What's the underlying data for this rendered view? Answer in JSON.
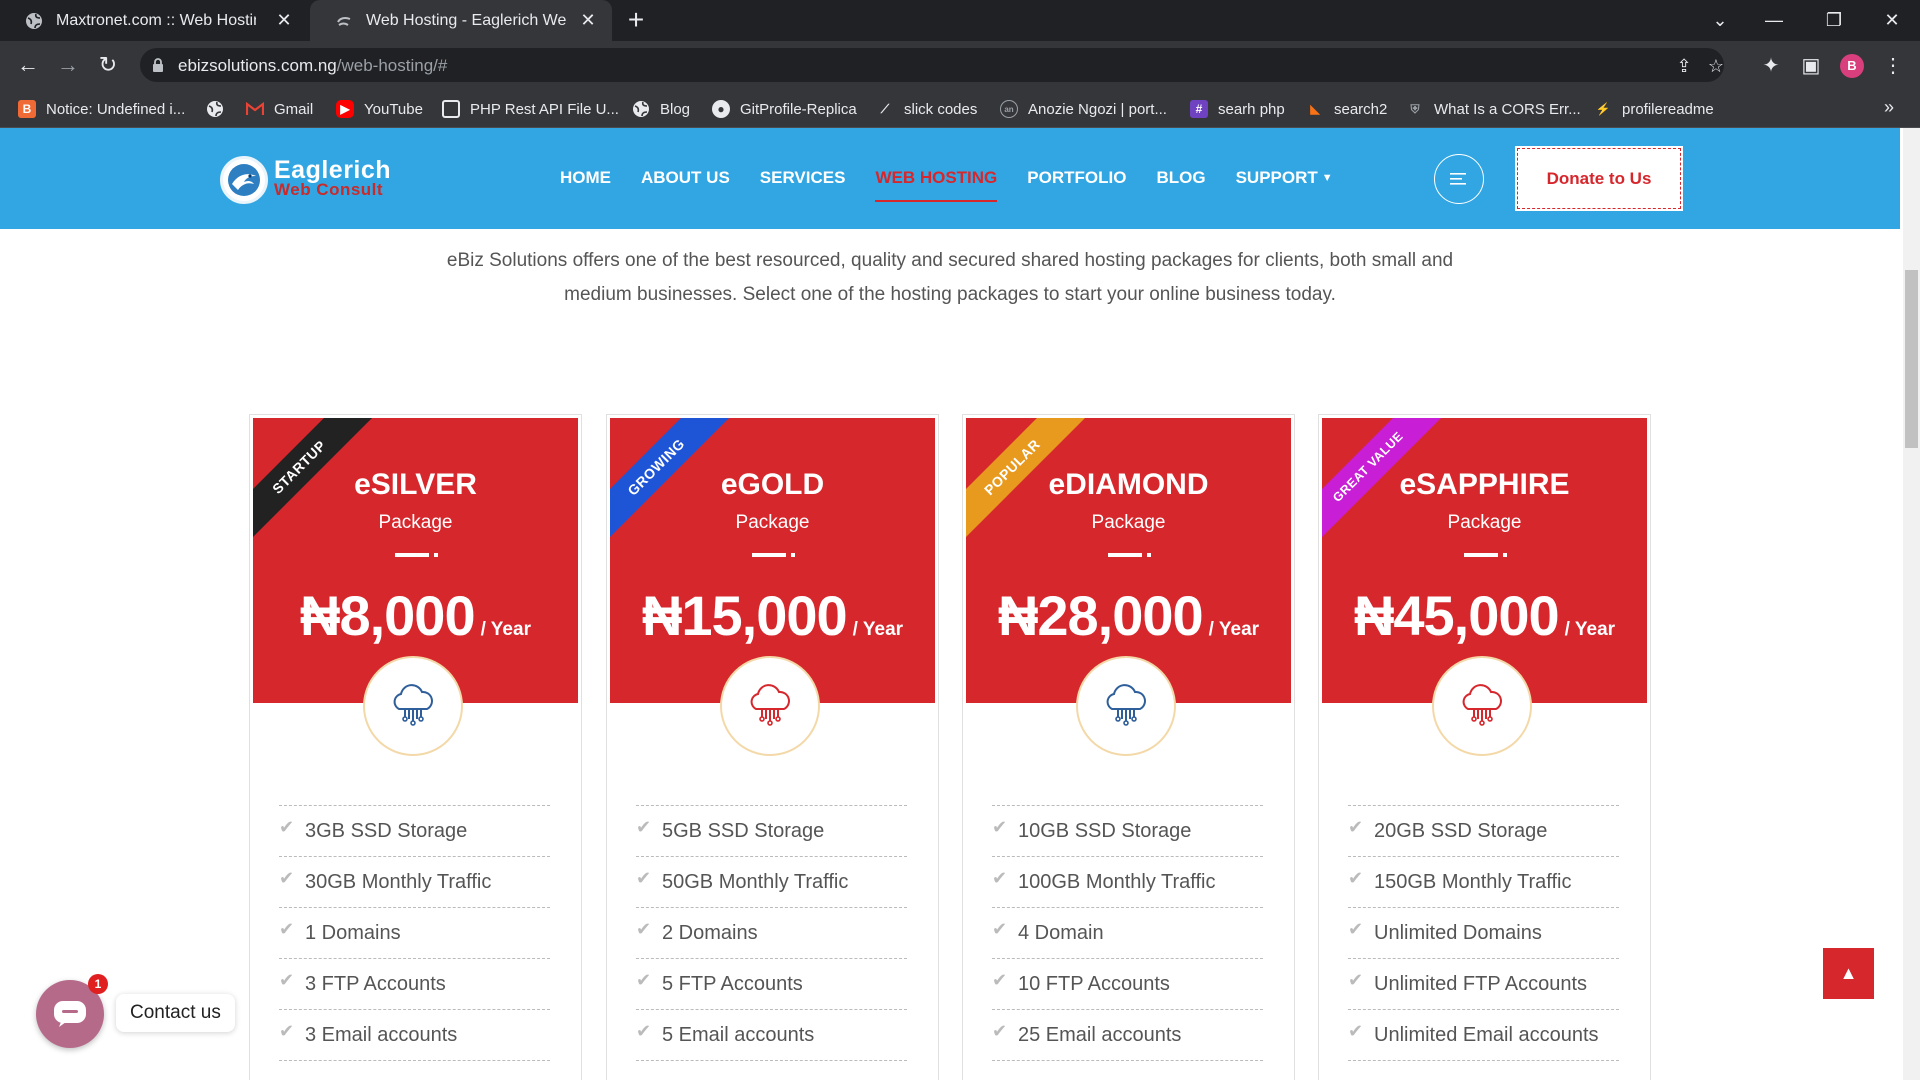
{
  "browser": {
    "tabs": [
      {
        "title": "Maxtronet.com :: Web Hosting"
      },
      {
        "title": "Web Hosting - Eaglerich Web Co"
      }
    ],
    "url_domain": "ebizsolutions.com.ng",
    "url_path": "/web-hosting/#",
    "profile_initial": "B",
    "bookmarks": [
      {
        "label": "Notice: Undefined i...",
        "icon": "bookmark-icon",
        "color": "#f06a35"
      },
      {
        "label": "",
        "icon": "globe-icon",
        "color": "#5f6368"
      },
      {
        "label": "Gmail",
        "icon": "gmail-icon",
        "color": "#ea4335"
      },
      {
        "label": "YouTube",
        "icon": "youtube-icon",
        "color": "#ff0000"
      },
      {
        "label": "PHP Rest API File U...",
        "icon": "page-icon",
        "color": "#5f6368"
      },
      {
        "label": "Blog",
        "icon": "globe-icon",
        "color": "#5f6368"
      },
      {
        "label": "GitProfile-Replica",
        "icon": "github-icon",
        "color": "#5f6368"
      },
      {
        "label": "slick codes",
        "icon": "slick-icon",
        "color": "#5f6368"
      },
      {
        "label": "Anozie Ngozi | port...",
        "icon": "portfolio-icon",
        "color": "#5f6368"
      },
      {
        "label": "searh php",
        "icon": "php-icon",
        "color": "#6f42c1"
      },
      {
        "label": "search2",
        "icon": "chart-icon",
        "color": "#f97316"
      },
      {
        "label": "What Is a CORS Err...",
        "icon": "shield-icon",
        "color": "#5f6368"
      },
      {
        "label": "profilereadme",
        "icon": "link-icon",
        "color": "#5f6368"
      }
    ]
  },
  "site": {
    "logo_line1": "Eaglerich",
    "logo_line2": "Web Consult",
    "nav": [
      {
        "label": "HOME",
        "active": false
      },
      {
        "label": "ABOUT US",
        "active": false
      },
      {
        "label": "SERVICES",
        "active": false
      },
      {
        "label": "WEB HOSTING",
        "active": true
      },
      {
        "label": "PORTFOLIO",
        "active": false
      },
      {
        "label": "BLOG",
        "active": false
      },
      {
        "label": "SUPPORT",
        "active": false
      }
    ],
    "donate_label": "Donate to Us",
    "intro_line1": "eBiz Solutions offers one of the best resourced, quality and secured shared hosting packages for clients, both small and",
    "intro_line2": "medium businesses. Select one of the hosting packages to start your online business today."
  },
  "colors": {
    "header_bg": "#32a6e2",
    "brand_red": "#d6272d",
    "card_top": "#d6272d"
  },
  "plans": [
    {
      "ribbon": "STARTUP",
      "ribbon_color": "#222222",
      "name": "eSILVER",
      "sub": "Package",
      "price": "₦8,000",
      "per": "/ Year",
      "icon_color": "#2f5f9a",
      "features": [
        "3GB SSD Storage",
        "30GB Monthly Traffic",
        "1 Domains",
        "3 FTP Accounts",
        "3 Email accounts"
      ]
    },
    {
      "ribbon": "GROWING",
      "ribbon_color": "#1e54d6",
      "name": "eGOLD",
      "sub": "Package",
      "price": "₦15,000",
      "per": "/ Year",
      "icon_color": "#d6272d",
      "features": [
        "5GB SSD Storage",
        "50GB Monthly Traffic",
        "2 Domains",
        "5 FTP Accounts",
        "5 Email accounts"
      ]
    },
    {
      "ribbon": "POPULAR",
      "ribbon_color": "#e89a1e",
      "name": "eDIAMOND",
      "sub": "Package",
      "price": "₦28,000",
      "per": "/ Year",
      "icon_color": "#2f5f9a",
      "features": [
        "10GB SSD Storage",
        "100GB Monthly Traffic",
        "4 Domain",
        "10 FTP Accounts",
        "25 Email accounts"
      ]
    },
    {
      "ribbon": "GREAT VALUE",
      "ribbon_color": "#c81fd6",
      "name": "eSAPPHIRE",
      "sub": "Package",
      "price": "₦45,000",
      "per": "/ Year",
      "icon_color": "#d6272d",
      "features": [
        "20GB SSD Storage",
        "150GB Monthly Traffic",
        "Unlimited Domains",
        "Unlimited FTP Accounts",
        "Unlimited Email accounts"
      ]
    }
  ],
  "widgets": {
    "contact_label": "Contact us",
    "contact_badge": "1"
  }
}
